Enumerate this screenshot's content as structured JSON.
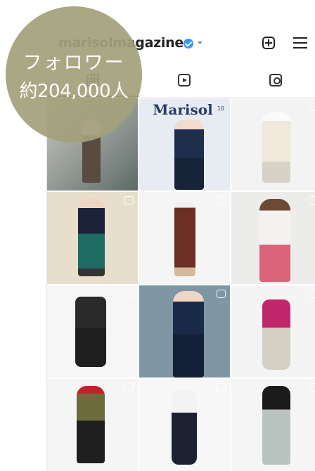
{
  "badge": {
    "line1": "フォロワー",
    "line2": "約204,000人"
  },
  "header": {
    "username": "marisolmagazine",
    "verified_icon": "verified-badge-icon",
    "dropdown_icon": "chevron-down-icon",
    "new_post_icon": "plus-square-icon",
    "menu_icon": "hamburger-menu-icon"
  },
  "tabs": [
    {
      "name": "posts",
      "icon": "grid-icon",
      "active": true
    },
    {
      "name": "reels",
      "icon": "reels-icon",
      "active": false
    },
    {
      "name": "tagged",
      "icon": "tagged-icon",
      "active": false
    }
  ],
  "magazine_cover": {
    "title": "Marisol",
    "issue": "10"
  },
  "colors": {
    "badge": "#a4a07b",
    "verified": "#3897f0",
    "text": "#222222"
  }
}
